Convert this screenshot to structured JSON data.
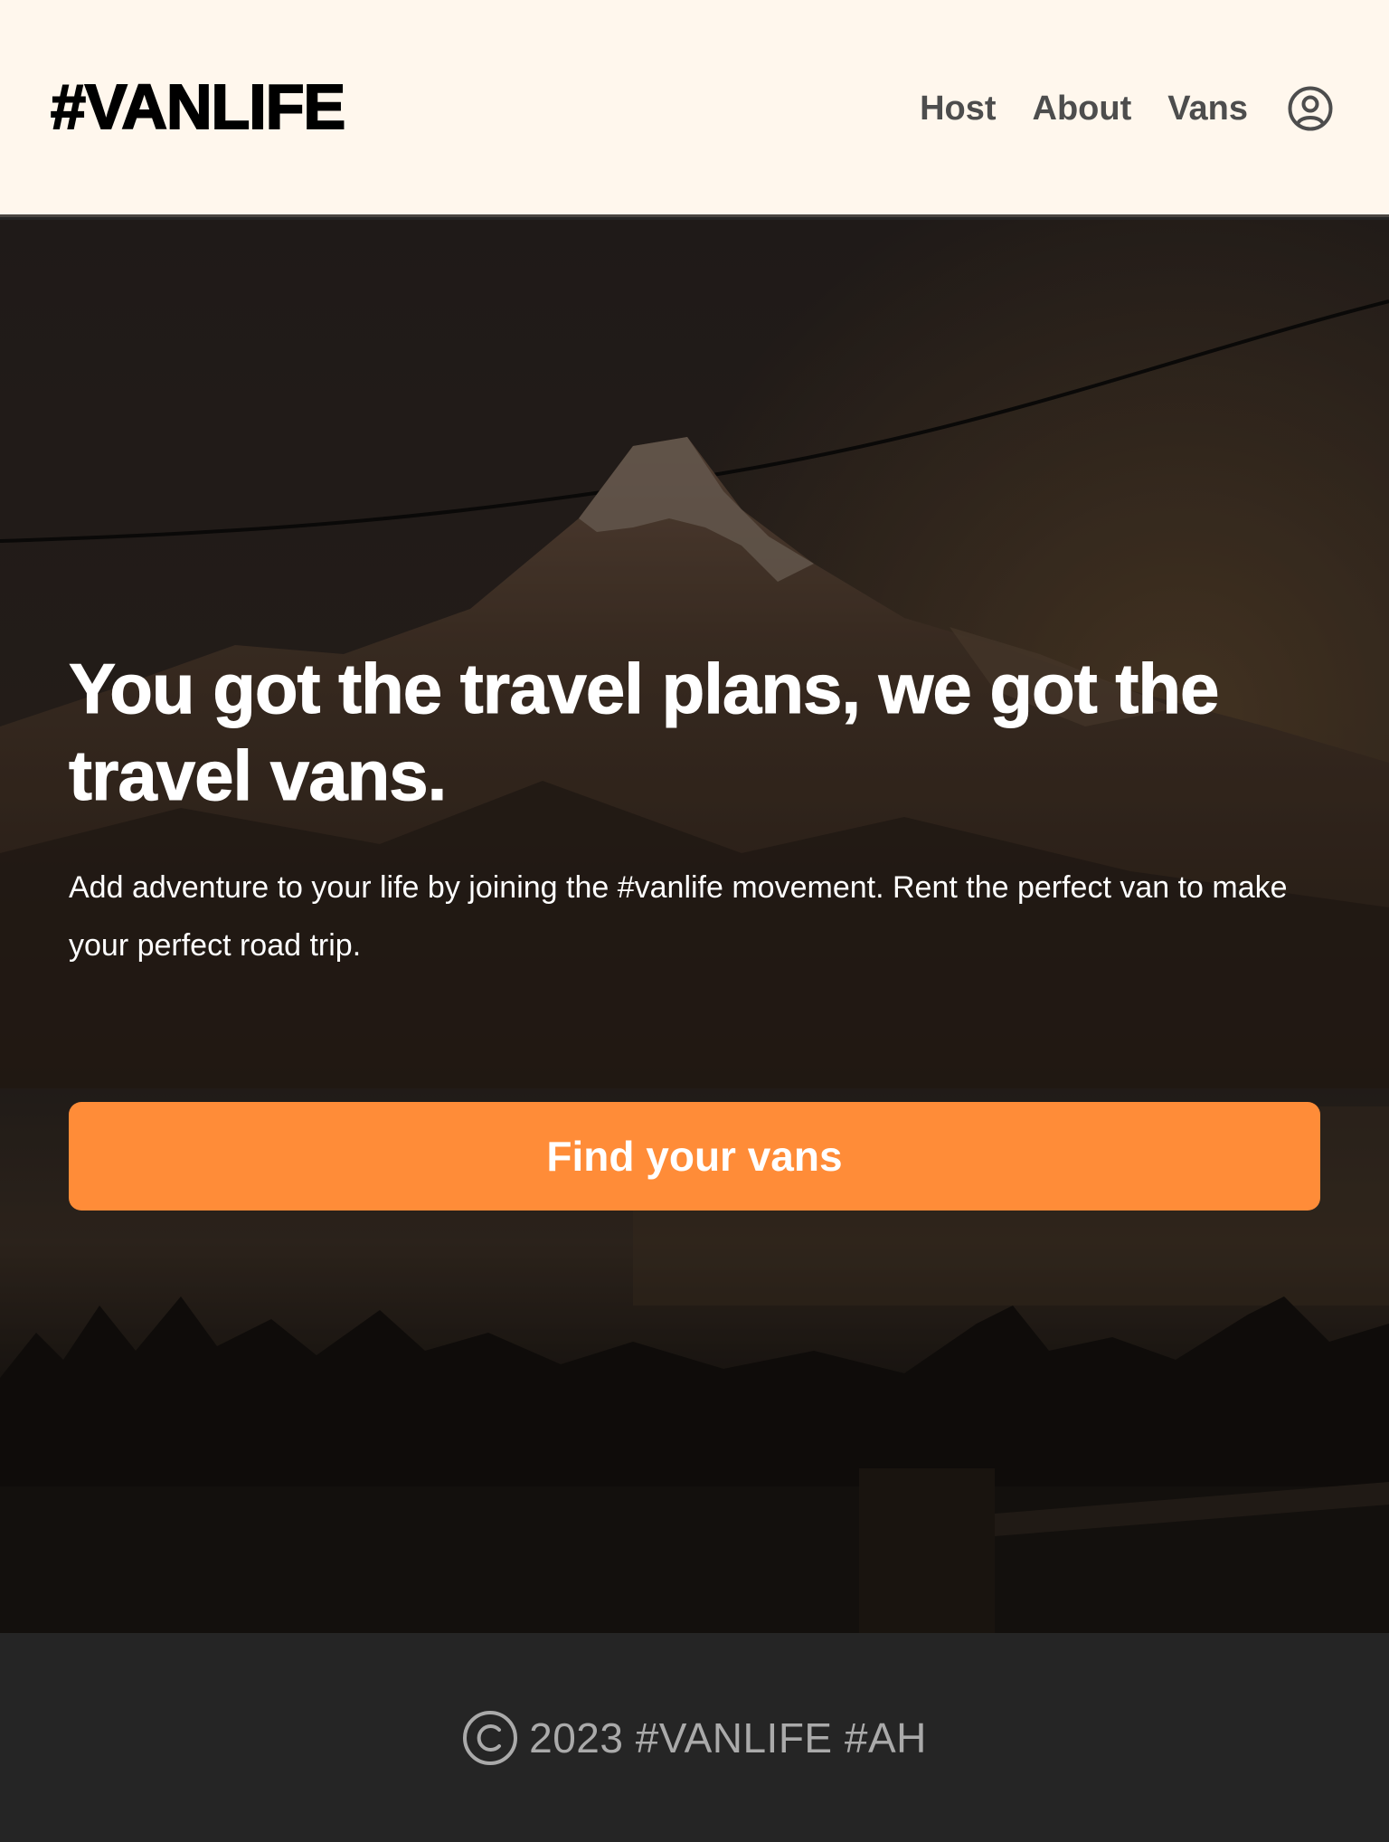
{
  "header": {
    "logo": "#VANLIFE",
    "nav": [
      {
        "label": "Host"
      },
      {
        "label": "About"
      },
      {
        "label": "Vans"
      }
    ],
    "user_icon": "user-circle-icon"
  },
  "hero": {
    "title": "You got the travel plans, we got the travel vans.",
    "text": "Add adventure to your life by joining the #vanlife movement. Rent the perfect van to make your perfect road trip.",
    "cta_label": "Find your vans",
    "background": "mountain-lake-photo"
  },
  "footer": {
    "text": "2023 #VANLIFE #AH",
    "icon": "copyright-icon"
  },
  "colors": {
    "header_bg": "#FFF7ED",
    "accent": "#FF8C38",
    "footer_bg": "#252525",
    "nav_text": "#4D4D4D",
    "footer_text": "#AAAAAA"
  }
}
